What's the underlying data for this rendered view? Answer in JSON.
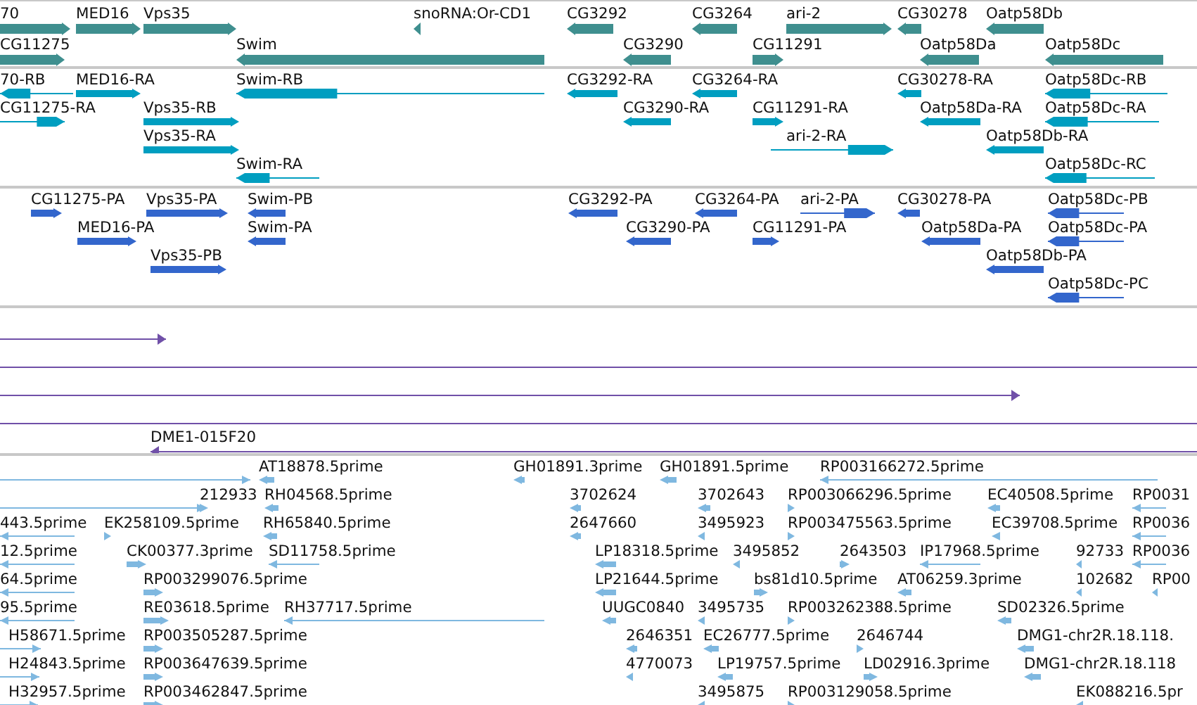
{
  "tracks": [
    {
      "kind": "gene",
      "color": "#3f8f8f",
      "lanes": [
        {
          "features": [
            {
              "label": "70",
              "reverse": false
            },
            {
              "label": "MED16",
              "reverse": false
            },
            {
              "label": "Vps35",
              "reverse": false
            },
            {
              "label": "snoRNA:Or-CD1",
              "reverse": true
            },
            {
              "label": "CG3292",
              "reverse": true
            },
            {
              "label": "CG3264",
              "reverse": true
            },
            {
              "label": "ari-2",
              "reverse": false
            },
            {
              "label": "CG30278",
              "reverse": true
            },
            {
              "label": "Oatp58Db",
              "reverse": true
            }
          ]
        },
        {
          "features": [
            {
              "label": "CG11275",
              "reverse": false
            },
            {
              "label": "Swim",
              "reverse": true
            },
            {
              "label": "CG3290",
              "reverse": true
            },
            {
              "label": "CG11291",
              "reverse": false
            },
            {
              "label": "Oatp58Da",
              "reverse": true
            },
            {
              "label": "Oatp58Dc",
              "reverse": true
            }
          ]
        }
      ]
    },
    {
      "kind": "transcript",
      "color": "#009ec0",
      "lanes": [
        {
          "features": [
            {
              "label": "70-RB",
              "reverse": true
            },
            {
              "label": "MED16-RA",
              "reverse": false
            },
            {
              "label": "Swim-RB",
              "reverse": true
            },
            {
              "label": "CG3292-RA",
              "reverse": true
            },
            {
              "label": "CG3264-RA",
              "reverse": true
            },
            {
              "label": "CG30278-RA",
              "reverse": true
            },
            {
              "label": "Oatp58Dc-RB",
              "reverse": true
            }
          ]
        },
        {
          "features": [
            {
              "label": "CG11275-RA",
              "reverse": false
            },
            {
              "label": "Vps35-RB",
              "reverse": false
            },
            {
              "label": "CG3290-RA",
              "reverse": true
            },
            {
              "label": "CG11291-RA",
              "reverse": false
            },
            {
              "label": "Oatp58Da-RA",
              "reverse": true
            },
            {
              "label": "Oatp58Dc-RA",
              "reverse": true
            }
          ]
        },
        {
          "features": [
            {
              "label": "Vps35-RA",
              "reverse": false
            },
            {
              "label": "ari-2-RA",
              "reverse": false
            },
            {
              "label": "Oatp58Db-RA",
              "reverse": true
            }
          ]
        },
        {
          "features": [
            {
              "label": "Swim-RA",
              "reverse": true
            },
            {
              "label": "Oatp58Dc-RC",
              "reverse": true
            }
          ]
        }
      ]
    },
    {
      "kind": "protein",
      "color": "#3366cc",
      "lanes": [
        {
          "features": [
            {
              "label": "CG11275-PA",
              "reverse": false
            },
            {
              "label": "Vps35-PA",
              "reverse": false
            },
            {
              "label": "Swim-PB",
              "reverse": true
            },
            {
              "label": "CG3292-PA",
              "reverse": true
            },
            {
              "label": "CG3264-PA",
              "reverse": true
            },
            {
              "label": "ari-2-PA",
              "reverse": false
            },
            {
              "label": "CG30278-PA",
              "reverse": true
            },
            {
              "label": "Oatp58Dc-PB",
              "reverse": true
            }
          ]
        },
        {
          "features": [
            {
              "label": "MED16-PA",
              "reverse": false
            },
            {
              "label": "Swim-PA",
              "reverse": true
            },
            {
              "label": "CG3290-PA",
              "reverse": true
            },
            {
              "label": "CG11291-PA",
              "reverse": false
            },
            {
              "label": "Oatp58Da-PA",
              "reverse": true
            },
            {
              "label": "Oatp58Dc-PA",
              "reverse": true
            }
          ]
        },
        {
          "features": [
            {
              "label": "Vps35-PB",
              "reverse": false
            },
            {
              "label": "Oatp58Db-PA",
              "reverse": true
            }
          ]
        },
        {
          "features": [
            {
              "label": "Oatp58Dc-PC",
              "reverse": true
            }
          ]
        }
      ]
    },
    {
      "kind": "clone",
      "color": "#7050a8",
      "lanes": [
        {
          "features": [
            {
              "kind": "arrow",
              "reverse": false
            }
          ]
        },
        {
          "features": [
            {
              "kind": "line"
            }
          ]
        },
        {
          "features": [
            {
              "kind": "arrow",
              "reverse": false
            }
          ]
        },
        {
          "features": [
            {
              "kind": "line"
            }
          ]
        },
        {
          "features": [
            {
              "kind": "arrow",
              "label": "DME1-015F20",
              "reverse": true
            }
          ]
        }
      ]
    },
    {
      "kind": "est",
      "color": "#7fb8e0",
      "lanes": [
        {
          "features": [
            {
              "reverse": false
            },
            {
              "label": "AT18878.5prime",
              "reverse": true
            },
            {
              "label": "GH01891.3prime",
              "reverse": true
            },
            {
              "label": "GH01891.5prime",
              "reverse": true
            },
            {
              "label": "RP003166272.5prime",
              "reverse": true
            }
          ]
        },
        {
          "features": [
            {
              "reverse": false
            },
            {
              "label": "212933",
              "reverse": false
            },
            {
              "label": "RH04568.5prime",
              "reverse": true
            },
            {
              "label": "3702624",
              "reverse": true
            },
            {
              "label": "3702643",
              "reverse": true
            },
            {
              "label": "RP003066296.5prime",
              "reverse": false
            },
            {
              "label": "EC40508.5prime",
              "reverse": true
            },
            {
              "label": "RP0031",
              "reverse": true
            }
          ]
        },
        {
          "features": [
            {
              "label": "443.5prime",
              "reverse": true
            },
            {
              "label": "EK258109.5prime",
              "reverse": false
            },
            {
              "label": "RH65840.5prime",
              "reverse": true
            },
            {
              "label": "2647660",
              "reverse": true
            },
            {
              "label": "3495923",
              "reverse": true
            },
            {
              "label": "RP003475563.5prime",
              "reverse": false
            },
            {
              "label": "EC39708.5prime",
              "reverse": true
            },
            {
              "label": "RP0036",
              "reverse": true
            }
          ]
        },
        {
          "features": [
            {
              "label": "12.5prime",
              "reverse": true
            },
            {
              "label": "CK00377.3prime",
              "reverse": false
            },
            {
              "label": "SD11758.5prime",
              "reverse": true
            },
            {
              "label": "LP18318.5prime",
              "reverse": true
            },
            {
              "label": "3495852",
              "reverse": true
            },
            {
              "label": "2643503",
              "reverse": false
            },
            {
              "label": "IP17968.5prime",
              "reverse": true
            },
            {
              "label": "92733",
              "reverse": true
            },
            {
              "label": "RP0036",
              "reverse": true
            }
          ]
        },
        {
          "features": [
            {
              "label": "64.5prime",
              "reverse": true
            },
            {
              "label": "RP003299076.5prime",
              "reverse": false
            },
            {
              "label": "LP21644.5prime",
              "reverse": true
            },
            {
              "label": "bs81d10.5prime",
              "reverse": false
            },
            {
              "label": "AT06259.3prime",
              "reverse": true
            },
            {
              "label": "102682",
              "reverse": true
            },
            {
              "label": "RP00",
              "reverse": true
            }
          ]
        },
        {
          "features": [
            {
              "label": "95.5prime",
              "reverse": true
            },
            {
              "label": "RE03618.5prime",
              "reverse": false
            },
            {
              "label": "RH37717.5prime",
              "reverse": true
            },
            {
              "label": "UUGC0840",
              "reverse": true
            },
            {
              "label": "3495735",
              "reverse": true
            },
            {
              "label": "RP003262388.5prime",
              "reverse": false
            },
            {
              "label": "SD02326.5prime",
              "reverse": true
            }
          ]
        },
        {
          "features": [
            {
              "label": "H58671.5prime",
              "reverse": false
            },
            {
              "label": "RP003505287.5prime",
              "reverse": false
            },
            {
              "label": "2646351",
              "reverse": true
            },
            {
              "label": "EC26777.5prime",
              "reverse": true
            },
            {
              "label": "2646744",
              "reverse": false
            },
            {
              "label": "DMG1-chr2R.18.118.",
              "reverse": true
            }
          ]
        },
        {
          "features": [
            {
              "label": "H24843.5prime",
              "reverse": false
            },
            {
              "label": "RP003647639.5prime",
              "reverse": false
            },
            {
              "label": "4770073",
              "reverse": true
            },
            {
              "label": "LP19757.5prime",
              "reverse": true
            },
            {
              "label": "LD02916.3prime",
              "reverse": false
            },
            {
              "label": "DMG1-chr2R.18.118",
              "reverse": true
            }
          ]
        },
        {
          "features": [
            {
              "label": "H32957.5prime",
              "reverse": false
            },
            {
              "label": "RP003462847.5prime",
              "reverse": false
            },
            {
              "label": "3495875",
              "reverse": true
            },
            {
              "label": "RP003129058.5prime",
              "reverse": false
            },
            {
              "label": "EK088216.5pr",
              "reverse": true
            }
          ]
        }
      ]
    }
  ]
}
